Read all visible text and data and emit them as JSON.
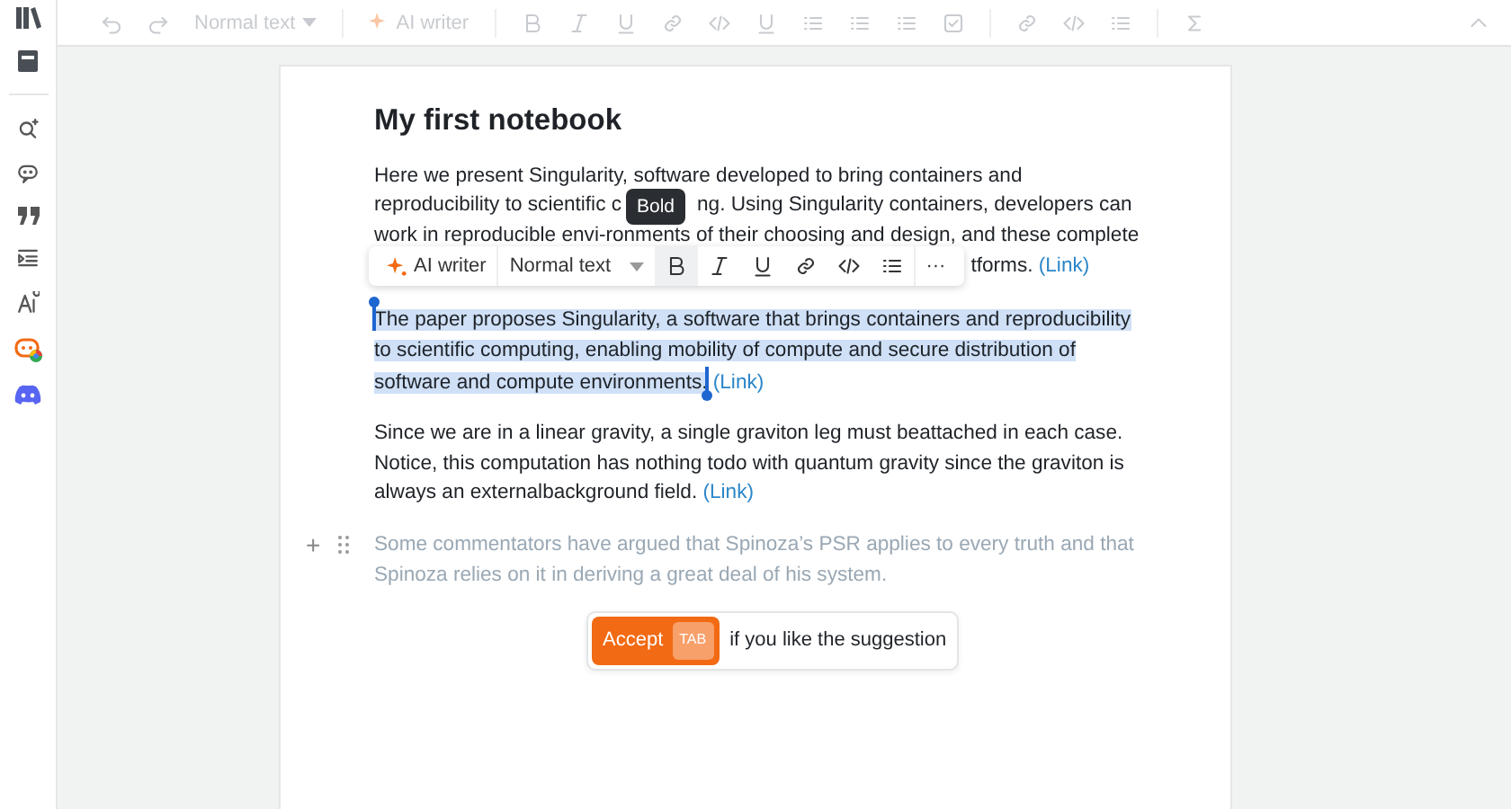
{
  "top_toolbar": {
    "disabled": true,
    "style_label": "Normal text",
    "ai_label": "AI writer"
  },
  "document": {
    "title": "My first notebook",
    "blocks": [
      {
        "kind": "covered",
        "lines": [
          [
            "Here we present Singularity, software developed to bring containers and"
          ],
          [
            "reproducibility to scientific c",
            "ng. Using Singularity containers, developers can"
          ],
          [
            "work in reproducible envi-ronments of their choosing and design, and these complete"
          ]
        ],
        "tail": "tforms.",
        "link": "(Link)"
      },
      {
        "kind": "text",
        "selected": true,
        "text": "The paper proposes Singularity, a software that brings containers and reproducibility to scientific computing, enabling mobility of compute and secure distribution of software and compute environments.",
        "link": "(Link)"
      },
      {
        "kind": "text",
        "selected": false,
        "text": "Since we are in a linear gravity, a single graviton leg must beattached in each case. Notice, this computation has nothing todo with quantum gravity since the graviton is always an externalbackground field.",
        "link": "(Link)"
      },
      {
        "kind": "suggestion",
        "add": "+",
        "text": "Some commentators have argued that Spinoza’s PSR applies to every truth and that Spinoza relies on it in deriving a great deal of his system."
      }
    ]
  },
  "inline_toolbar": {
    "ai_label": "AI writer",
    "style_label": "Normal text",
    "more": "···",
    "buttons": [
      {
        "kind": "bold",
        "hovered": true
      },
      {
        "kind": "italic",
        "hovered": false
      },
      {
        "kind": "underline",
        "hovered": false
      },
      {
        "kind": "link",
        "hovered": false
      },
      {
        "kind": "code",
        "hovered": false
      },
      {
        "kind": "list",
        "hovered": false
      }
    ]
  },
  "tooltip": "Bold",
  "accept_bar": {
    "button": "Accept",
    "key": "TAB",
    "hint": "if you like the suggestion"
  }
}
